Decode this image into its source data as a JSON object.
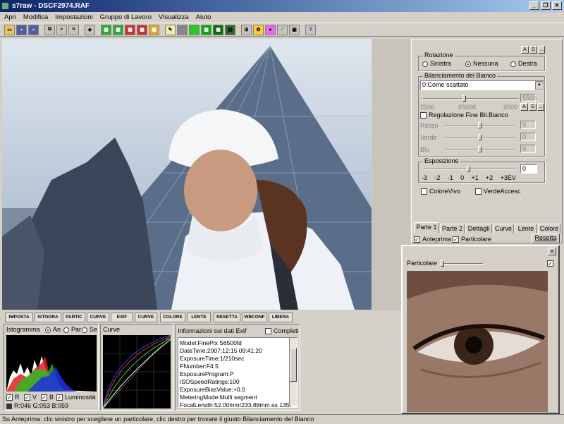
{
  "window": {
    "title": "s7raw - DSCF2974.RAF"
  },
  "menu": [
    "Apri",
    "Modifica",
    "Impostazioni",
    "Gruppo di Lavoro",
    "Visualizza",
    "Aiuto"
  ],
  "rotation": {
    "label": "Rotazione",
    "options": [
      "Sinistra",
      "Nessuna",
      "Destra"
    ],
    "selected": "Nessuna",
    "btn_a": "A",
    "btn_s": "S",
    "btn_more": "..."
  },
  "white_balance": {
    "label": "Bilanciamento del Bianco",
    "preset": "0:Come scattato",
    "value": "5500",
    "scale": [
      "2500",
      "6500K",
      "9500"
    ],
    "fine_label": "Regolazione Fine Bil.Bianco",
    "rosso": "Rosso",
    "verde": "Verde",
    "blu": "Blu",
    "rosso_val": "0",
    "verde_val": "0",
    "blu_val": "0"
  },
  "exposure": {
    "label": "Esposizione",
    "value": "0",
    "scale": [
      "-3",
      "-2",
      "-1",
      "0",
      "+1",
      "+2",
      "+3EV"
    ]
  },
  "options": {
    "colore_vivo": "ColoreVivo",
    "verde_accese": "VerdeAccesc"
  },
  "tabs": [
    "Parte 1",
    "Parte 2",
    "Dettagli",
    "Curve",
    "Lente",
    "Colore"
  ],
  "preview": {
    "anteprima": "Anteprima",
    "particolare": "Particolare",
    "resetta": "Resetta"
  },
  "bottom_tabs": [
    "IMPOSTA",
    "ISTOGRA",
    "PARTIC",
    "CURVE",
    "EXIF",
    "CURVE",
    "COLORE",
    "LENTE",
    "RESETTA",
    "WBCONF",
    "LIBERA"
  ],
  "histogram": {
    "label": "Istogramma",
    "modes": [
      "An",
      "Par",
      "Se"
    ],
    "r": "R",
    "v": "V",
    "b": "B",
    "lum": "Luminosità",
    "readout": "R:046 G:053 B:059"
  },
  "curve": {
    "label": "Curve"
  },
  "exif": {
    "label": "Informazioni sui dati Exif",
    "completi": "Completi",
    "lines": [
      "Model:FinePix S6500fd",
      "DateTime:2007:12:15 09:41:20",
      "ExposureTime:1/210sec",
      "FNumber:F4.5",
      "ExposureProgram:P",
      "ISOSpeedRatings:100",
      "ExposureBiasValue:+0.0",
      "MeteringMode:Multi segment",
      "FocalLength:52.00mm(233.88mm as 135)"
    ]
  },
  "popup": {
    "label": "Particolare"
  },
  "status": "Su Anteprima: clic sinistro per scegliere un particolare, clic destro per trovare il giusto Bilanciamento del Bianco"
}
